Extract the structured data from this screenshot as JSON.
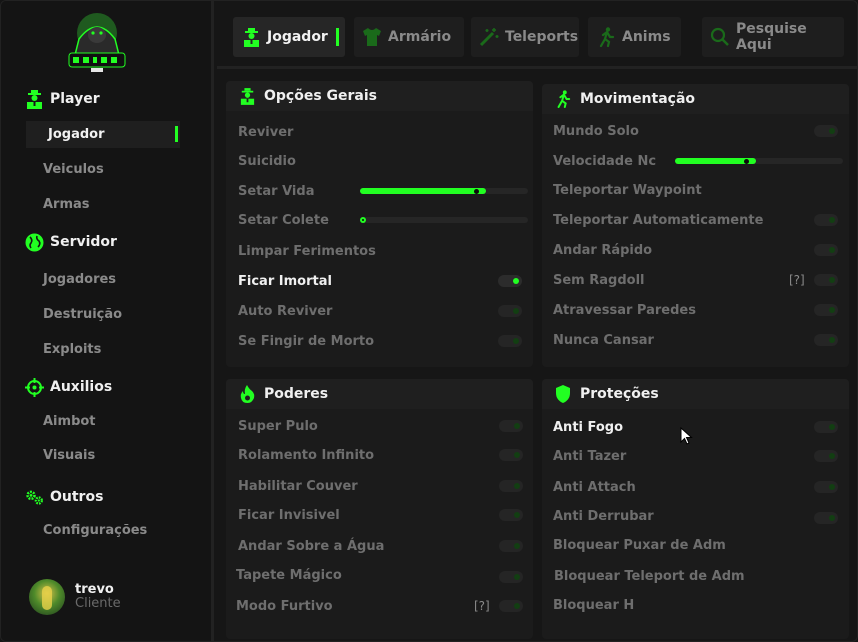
{
  "colors": {
    "accent": "#22ff22",
    "bg": "#161616",
    "panel": "#1b1b1b"
  },
  "sidebar": {
    "logo": "gorilla-logo",
    "sections": [
      {
        "label": "Player",
        "icon": "agent-icon"
      },
      {
        "label": "Servidor",
        "icon": "globe-icon"
      },
      {
        "label": "Auxilios",
        "icon": "crosshair-icon"
      },
      {
        "label": "Outros",
        "icon": "gears-icon"
      }
    ],
    "items": {
      "jogador": "Jogador",
      "veiculos": "Veiculos",
      "armas": "Armas",
      "jogadores": "Jogadores",
      "destruicao": "Destruição",
      "exploits": "Exploits",
      "aimbot": "Aimbot",
      "visuais": "Visuais",
      "configuracoes": "Configurações"
    },
    "user": {
      "name": "trevo",
      "role": "Cliente"
    }
  },
  "tabs": {
    "jogador": "Jogador",
    "armario": "Armário",
    "teleports": "Teleports",
    "anims": "Anims",
    "search_placeholder": "Pesquise Aqui"
  },
  "panels": {
    "opcoes_gerais": {
      "title": "Opções Gerais",
      "rows": {
        "reviver": "Reviver",
        "suicidio": "Suicidio",
        "setar_vida": "Setar Vida",
        "setar_colete": "Setar Colete",
        "limpar_ferimentos": "Limpar Ferimentos",
        "ficar_imortal": "Ficar Imortal",
        "auto_reviver": "Auto Reviver",
        "se_fingir": "Se Fingir de Morto"
      },
      "setar_vida_level": 0.75,
      "setar_colete_level": 0.0,
      "ficar_imortal_on": true
    },
    "movimentacao": {
      "title": "Movimentação",
      "rows": {
        "mundo_solo": "Mundo Solo",
        "velocidade_nc": "Velocidade Nc",
        "teleportar_waypoint": "Teleportar Waypoint",
        "teleportar_auto": "Teleportar Automaticamente",
        "andar_rapido": "Andar Rápido",
        "sem_ragdoll": "Sem Ragdoll",
        "atravessar_paredes": "Atravessar Paredes",
        "nunca_cansar": "Nunca Cansar"
      },
      "help": "[?]",
      "velocidade_level": 0.48
    },
    "poderes": {
      "title": "Poderes",
      "rows": {
        "super_pulo": "Super Pulo",
        "rolamento": "Rolamento Infinito",
        "habilitar_couver": "Habilitar Couver",
        "ficar_invisivel": "Ficar Invisivel",
        "andar_agua": "Andar Sobre a Água",
        "tapete": "Tapete Mágico",
        "modo_furtivo": "Modo Furtivo"
      },
      "help": "[?]"
    },
    "protecoes": {
      "title": "Proteções",
      "rows": {
        "anti_fogo": "Anti Fogo",
        "anti_tazer": "Anti Tazer",
        "anti_attach": "Anti Attach",
        "anti_derrubar": "Anti Derrubar",
        "bloquear_puxar": "Bloquear Puxar de Adm",
        "bloquear_teleport": "Bloquear Teleport de Adm",
        "bloquear_h": "Bloquear H"
      }
    }
  }
}
